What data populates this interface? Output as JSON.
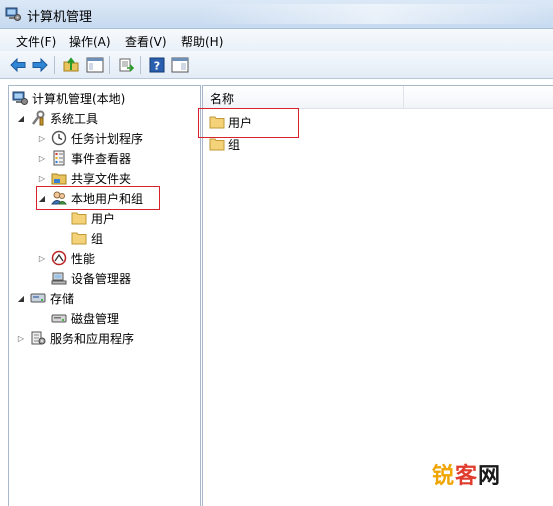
{
  "window": {
    "title": "计算机管理"
  },
  "menu": [
    {
      "label": "文件(F)"
    },
    {
      "label": "操作(A)"
    },
    {
      "label": "查看(V)"
    },
    {
      "label": "帮助(H)"
    }
  ],
  "toolbar": {
    "buttons": [
      "back-arrow-icon",
      "forward-arrow-icon",
      "up-folder-icon",
      "show-hide-tree-icon",
      "export-list-icon",
      "help-icon",
      "properties-icon"
    ]
  },
  "tree": {
    "root": "计算机管理(本地)",
    "system_tools": "系统工具",
    "task_scheduler": "任务计划程序",
    "event_viewer": "事件查看器",
    "shared_folders": "共享文件夹",
    "local_users_groups": "本地用户和组",
    "users": "用户",
    "groups": "组",
    "performance": "性能",
    "device_manager": "设备管理器",
    "storage": "存储",
    "disk_management": "磁盘管理",
    "services_apps": "服务和应用程序"
  },
  "list": {
    "column_name": "名称",
    "items": [
      "用户",
      "组"
    ]
  },
  "watermark": {
    "part1": "锐",
    "part2": "客",
    "part3": "网"
  },
  "colors": {
    "highlight": "#d8232a",
    "folder": "#f3d27a"
  }
}
